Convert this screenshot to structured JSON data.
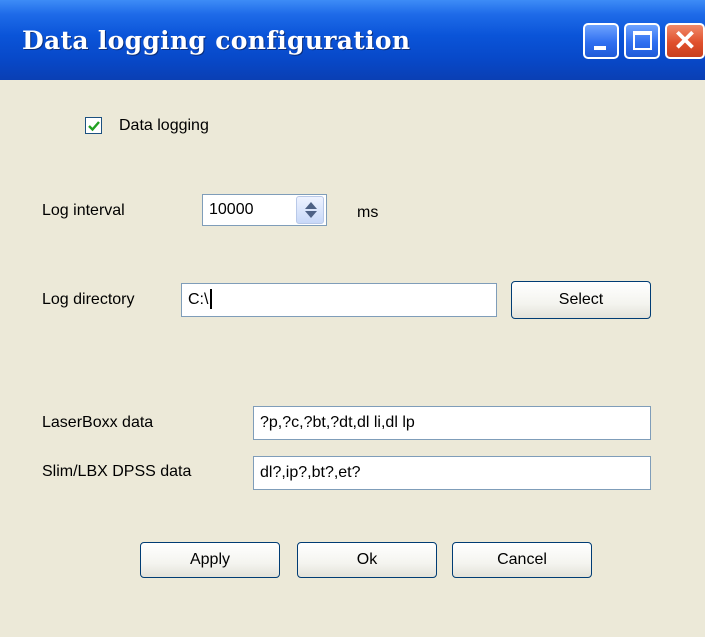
{
  "window": {
    "title": "Data logging configuration",
    "controls": [
      "minimize-icon",
      "maximize-icon",
      "close-icon"
    ],
    "title_bar_color": "#0a54d8",
    "background": "#ece9d8"
  },
  "data_logging": {
    "label": "Data logging",
    "checked": true
  },
  "log_interval": {
    "label": "Log interval",
    "value": "10000",
    "unit": "ms"
  },
  "log_directory": {
    "label": "Log directory",
    "value": "C:\\",
    "select_label": "Select"
  },
  "laserboxx": {
    "label": "LaserBoxx data",
    "value": "?p,?c,?bt,?dt,dl li,dl lp"
  },
  "slim": {
    "label": "Slim/LBX DPSS data",
    "value": "dl?,ip?,bt?,et?"
  },
  "buttons": {
    "apply": "Apply",
    "ok": "Ok",
    "cancel": "Cancel"
  }
}
